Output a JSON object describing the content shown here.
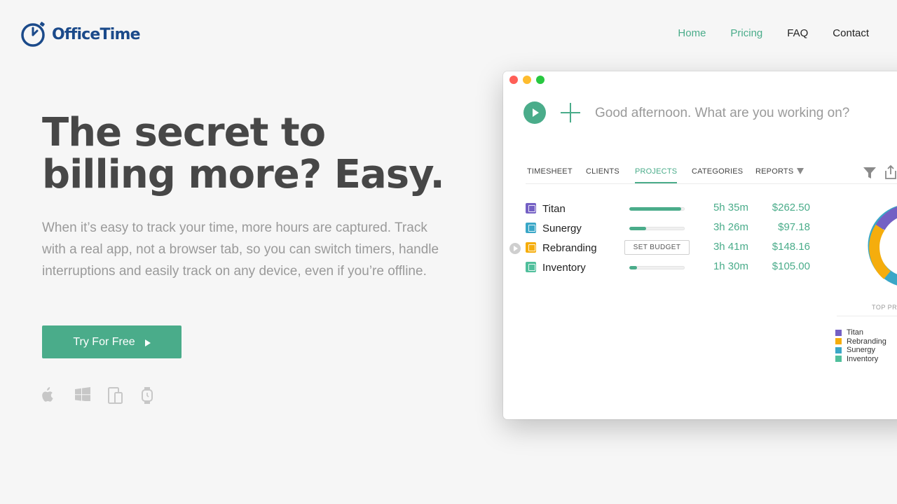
{
  "brand": {
    "name": "OfficeTime",
    "color": "#1b4a8a"
  },
  "nav": [
    {
      "label": "Home",
      "color": "#4aac8a"
    },
    {
      "label": "Pricing",
      "color": "#4aac8a"
    },
    {
      "label": "FAQ",
      "color": "#222222"
    },
    {
      "label": "Contact",
      "color": "#222222"
    }
  ],
  "hero": {
    "headline_line1": "The secret to",
    "headline_line2": "billing more? Easy.",
    "subtext": "When it’s easy to track your time, more hours are captured. Track with a real app, not a browser tab, so you can switch timers, handle interruptions and easily track on any device, even if you’re offline.",
    "cta_label": "Try For Free",
    "platform_icons": [
      "apple-icon",
      "windows-icon",
      "mobile-devices-icon",
      "watch-icon"
    ]
  },
  "app": {
    "greeting": "Good afternoon. What are you working on?",
    "tabs": [
      {
        "label": "TIMESHEET",
        "active": false
      },
      {
        "label": "CLIENTS",
        "active": false
      },
      {
        "label": "PROJECTS",
        "active": true
      },
      {
        "label": "CATEGORIES",
        "active": false
      },
      {
        "label": "REPORTS",
        "active": false
      }
    ],
    "budget_label": "SET BUDGET",
    "projects": [
      {
        "name": "Titan",
        "time": "5h 35m",
        "amount": "$262.50",
        "color": "#7460c4",
        "progress": 0.94
      },
      {
        "name": "Sunergy",
        "time": "3h 26m",
        "amount": "$97.18",
        "color": "#3aa7c7",
        "progress": 0.3
      },
      {
        "name": "Rebranding",
        "time": "3h 41m",
        "amount": "$148.16",
        "color": "#f5ad0d",
        "progress": null
      },
      {
        "name": "Inventory",
        "time": "1h 30m",
        "amount": "$105.00",
        "color": "#50bf9c",
        "progress": 0.14
      }
    ],
    "chart": {
      "caption": "TOP PRO",
      "legend": [
        {
          "name": "Titan",
          "color": "#7460c4"
        },
        {
          "name": "Rebranding",
          "color": "#f5ad0d"
        },
        {
          "name": "Sunergy",
          "color": "#3aa7c7"
        },
        {
          "name": "Inventory",
          "color": "#50bf9c"
        }
      ]
    }
  }
}
